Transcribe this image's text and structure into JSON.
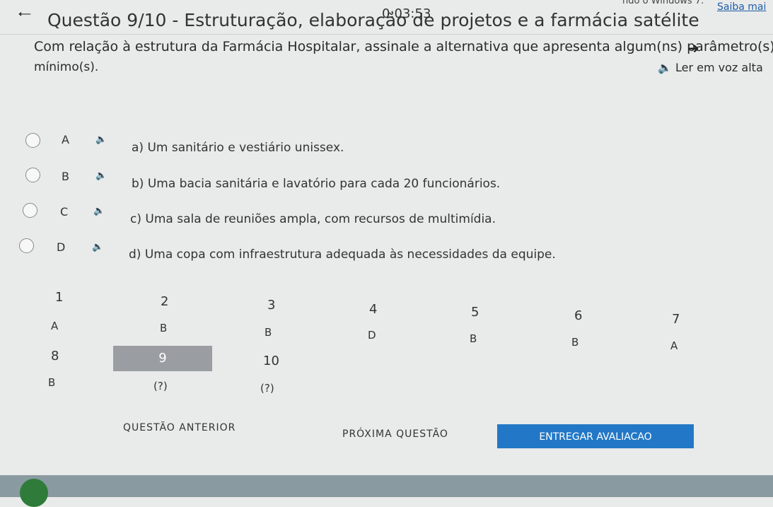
{
  "top_note": "ndo o Windows 7.",
  "saiba_link": "Saiba mai",
  "timer": "0:03:53",
  "question": {
    "title": "Questão 9/10 - Estruturação, elaboração de projetos e a farmácia satélite",
    "line1": "Com relação à estrutura da Farmácia Hospitalar, assinale a alternativa que apresenta algum(ns) parâmetro(s)",
    "line2": "mínimo(s).",
    "tts_label": "Ler em voz alta"
  },
  "options": [
    {
      "letter": "A",
      "text": "a) Um sanitário e vestiário unissex."
    },
    {
      "letter": "B",
      "text": "b) Uma bacia sanitária e lavatório para cada 20 funcionários."
    },
    {
      "letter": "C",
      "text": "c) Uma sala de reuniões ampla, com recursos de multimídia."
    },
    {
      "letter": "D",
      "text": "d) Uma copa com infraestrutura adequada às necessidades da equipe."
    }
  ],
  "grid": [
    {
      "num": "1",
      "ans": "A"
    },
    {
      "num": "2",
      "ans": "B"
    },
    {
      "num": "3",
      "ans": "B"
    },
    {
      "num": "4",
      "ans": "D"
    },
    {
      "num": "5",
      "ans": "B"
    },
    {
      "num": "6",
      "ans": "B"
    },
    {
      "num": "7",
      "ans": "A"
    },
    {
      "num": "8",
      "ans": "B"
    },
    {
      "num": "9",
      "ans": "(?)"
    },
    {
      "num": "10",
      "ans": "(?)"
    }
  ],
  "footer": {
    "prev": "QUESTÃO ANTERIOR",
    "next": "PRÓXIMA QUESTÃO",
    "submit": "ENTREGAR AVALIACAO"
  },
  "colors": {
    "accent": "#2278c6",
    "current": "#9a9ea3"
  }
}
